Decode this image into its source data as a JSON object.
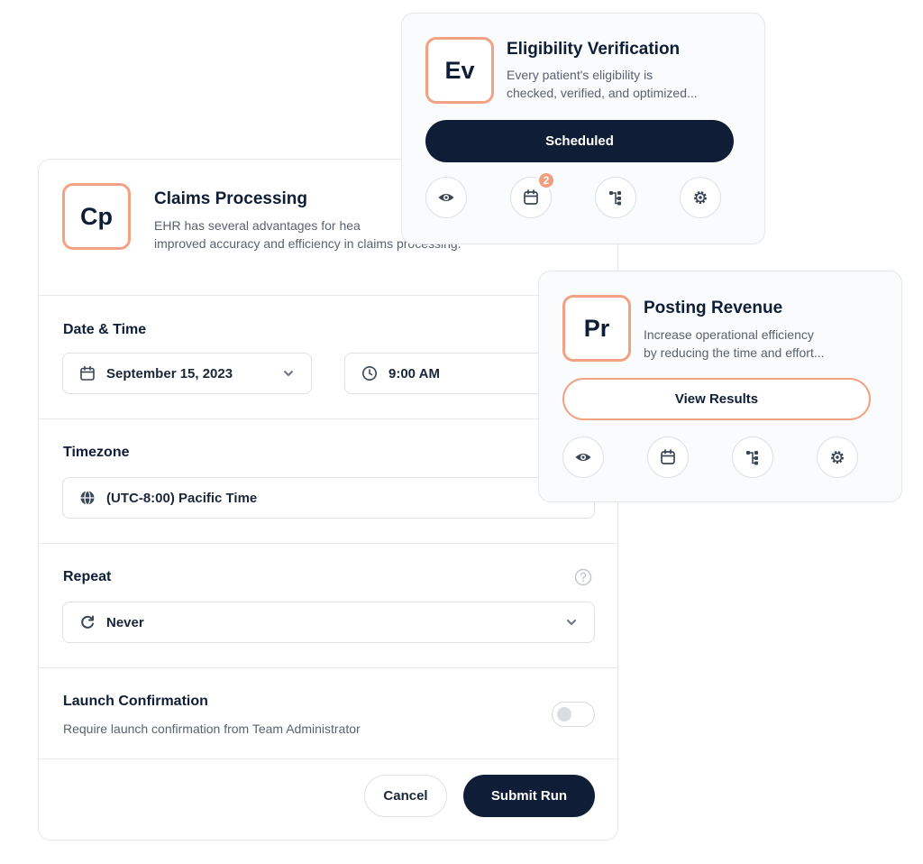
{
  "claims": {
    "monogram": "Cp",
    "title": "Claims Processing",
    "desc_line1": "EHR has several advantages for hea",
    "desc_line2": "improved accuracy and efficiency in claims processing.",
    "date_time_label": "Date & Time",
    "date_value": "September 15, 2023",
    "time_value": "9:00 AM",
    "timezone_label": "Timezone",
    "timezone_value": "(UTC-8:00) Pacific Time",
    "repeat_label": "Repeat",
    "repeat_value": "Never",
    "launch_label": "Launch Confirmation",
    "launch_desc": "Require launch confirmation from Team Administrator",
    "cancel_label": "Cancel",
    "submit_label": "Submit Run"
  },
  "eligibility": {
    "monogram": "Ev",
    "title": "Eligibility Verification",
    "desc_line1": "Every patient's eligibility is",
    "desc_line2": "checked, verified, and optimized...",
    "status_label": "Scheduled",
    "calendar_badge": "2"
  },
  "posting": {
    "monogram": "Pr",
    "title": "Posting Revenue",
    "desc_line1": "Increase operational efficiency",
    "desc_line2": "by reducing the time and effort...",
    "action_label": "View Results"
  },
  "icons": [
    "calendar-icon",
    "clock-icon",
    "globe-icon",
    "refresh-icon",
    "chevron-down-icon",
    "help-icon",
    "eye-icon",
    "workflow-icon",
    "gear-icon"
  ],
  "colors": {
    "navy": "#0f1e36",
    "accent": "#f2a183",
    "muted": "#5a6270",
    "border": "#dde1e7"
  }
}
